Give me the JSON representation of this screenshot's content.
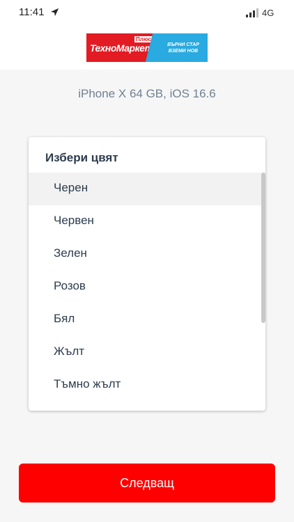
{
  "status_bar": {
    "time": "11:41",
    "network": "4G"
  },
  "header": {
    "logo": {
      "brand": "ТехноМаркет",
      "plus": "Плюс",
      "tagline_line1": "ВЪРНИ СТАР",
      "tagline_line2": "ВЗЕМИ НОВ",
      "colors": {
        "red": "#e31b23",
        "blue": "#29aae1"
      }
    }
  },
  "device": {
    "label": "iPhone X 64 GB, iOS 16.6"
  },
  "color_picker": {
    "title": "Избери цвят",
    "options": [
      "Черен",
      "Червен",
      "Зелен",
      "Розов",
      "Бял",
      "Жълт",
      "Тъмно жълт"
    ],
    "selected": "Черен"
  },
  "footer": {
    "next_label": "Следващ",
    "button_color": "#ff0000"
  }
}
